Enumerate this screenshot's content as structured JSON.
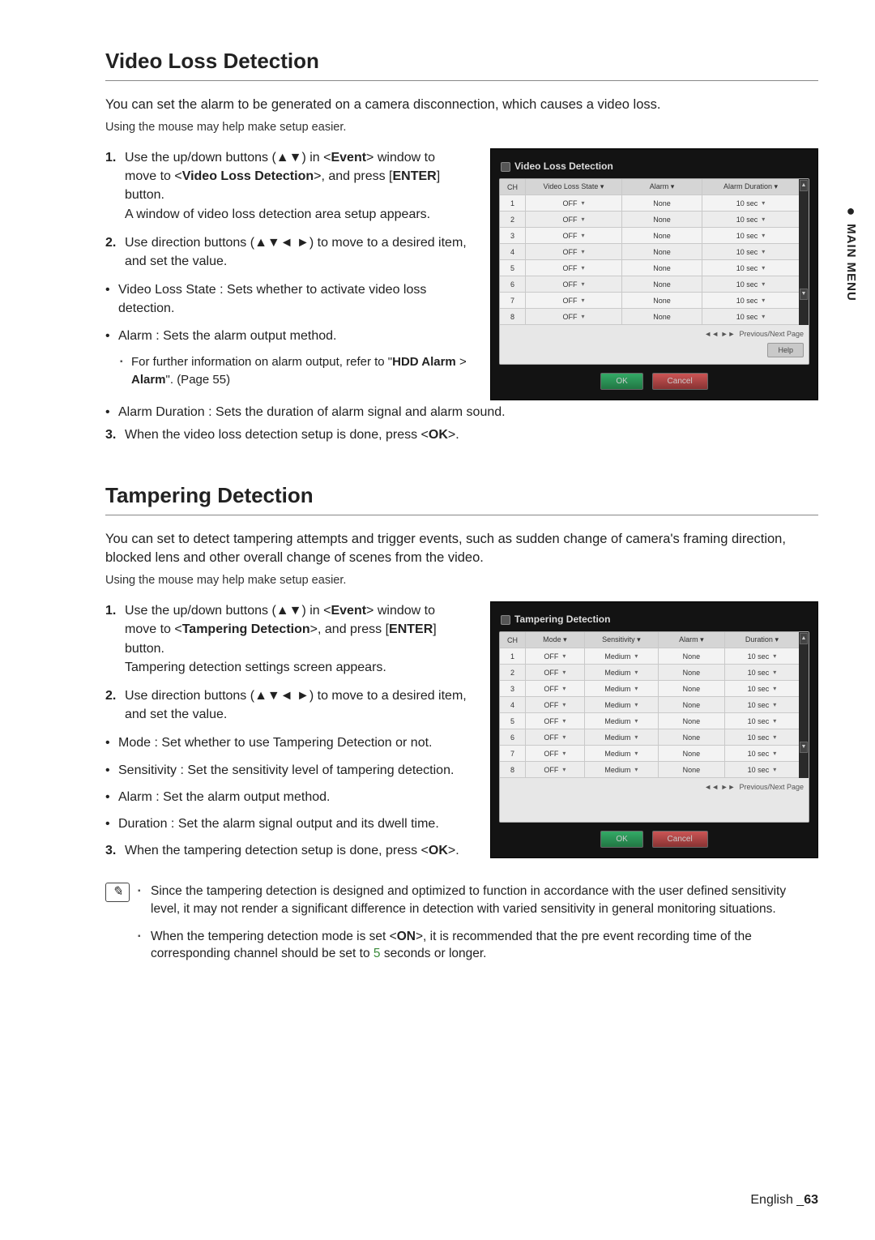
{
  "side_tab": {
    "bullet": "●",
    "label": "MAIN MENU"
  },
  "vld": {
    "title": "Video Loss Detection",
    "intro": "You can set the alarm to be generated on a camera disconnection, which causes a video loss.",
    "sub": "Using the mouse may help make setup easier.",
    "step1": {
      "num": "1.",
      "a": "Use the up/down buttons (▲▼) in <",
      "b": "Event",
      "c": "> window to move to <",
      "d": "Video Loss Detection",
      "e": ">, and press [",
      "f": "ENTER",
      "g": "] button.",
      "h": "A window of video loss detection area setup appears."
    },
    "step2": {
      "num": "2.",
      "txt": "Use direction buttons (▲▼◄ ►) to move to a desired item, and set the value."
    },
    "b1": "Video Loss State : Sets whether to activate video loss detection.",
    "b2": "Alarm : Sets the alarm output method.",
    "b2n_a": "For further information on alarm output, refer to \"",
    "b2n_b": "HDD Alarm",
    "b2n_c": " > ",
    "b2n_d": "Alarm",
    "b2n_e": "\". (Page 55)",
    "b3": "Alarm Duration : Sets the duration of alarm signal and alarm sound.",
    "step3": {
      "num": "3.",
      "a": "When the video loss detection setup is done, press <",
      "b": "OK",
      "c": ">."
    },
    "dialog": {
      "title": "Video Loss Detection",
      "headers": [
        "CH",
        "Video Loss State ▾",
        "Alarm ▾",
        "Alarm Duration ▾"
      ],
      "rows": [
        {
          "ch": "1",
          "state": "OFF",
          "alarm": "None",
          "dur": "10 sec"
        },
        {
          "ch": "2",
          "state": "OFF",
          "alarm": "None",
          "dur": "10 sec"
        },
        {
          "ch": "3",
          "state": "OFF",
          "alarm": "None",
          "dur": "10 sec"
        },
        {
          "ch": "4",
          "state": "OFF",
          "alarm": "None",
          "dur": "10 sec"
        },
        {
          "ch": "5",
          "state": "OFF",
          "alarm": "None",
          "dur": "10 sec"
        },
        {
          "ch": "6",
          "state": "OFF",
          "alarm": "None",
          "dur": "10 sec"
        },
        {
          "ch": "7",
          "state": "OFF",
          "alarm": "None",
          "dur": "10 sec"
        },
        {
          "ch": "8",
          "state": "OFF",
          "alarm": "None",
          "dur": "10 sec"
        }
      ],
      "pager_arrows": "◄◄ ►►",
      "pager": "Previous/Next Page",
      "help": "Help",
      "ok": "OK",
      "cancel": "Cancel"
    }
  },
  "td": {
    "title": "Tampering Detection",
    "intro": "You can set to detect tampering attempts and trigger events, such as sudden change of camera's framing direction, blocked lens and other overall change of scenes from the video.",
    "sub": "Using the mouse may help make setup easier.",
    "step1": {
      "num": "1.",
      "a": "Use the up/down buttons (▲▼) in <",
      "b": "Event",
      "c": "> window to move to <",
      "d": "Tampering Detection",
      "e": ">, and press [",
      "f": "ENTER",
      "g": "] button.",
      "h": "Tampering detection settings screen appears."
    },
    "step2": {
      "num": "2.",
      "txt": "Use direction buttons (▲▼◄ ►) to move to a desired item, and set the value."
    },
    "b1": "Mode : Set whether to use Tampering Detection or not.",
    "b2": "Sensitivity : Set the sensitivity level of tampering detection.",
    "b3": "Alarm : Set the alarm output method.",
    "b4": "Duration : Set the alarm signal output and its dwell time.",
    "step3": {
      "num": "3.",
      "a": "When the tampering detection setup is done, press <",
      "b": "OK",
      "c": ">."
    },
    "note1": "Since the tampering detection is designed and optimized to function in accordance with the user defined sensitivity level, it may not render a significant difference in detection with varied sensitivity in general monitoring situations.",
    "note2_a": "When the tempering detection mode is set <",
    "note2_b": "ON",
    "note2_c": ">, it is recommended that the pre event recording time of the corresponding channel should be set to ",
    "note2_d": "5",
    "note2_e": " seconds or longer.",
    "dialog": {
      "title": "Tampering Detection",
      "headers": [
        "CH",
        "Mode ▾",
        "Sensitivity ▾",
        "Alarm ▾",
        "Duration ▾"
      ],
      "rows": [
        {
          "ch": "1",
          "mode": "OFF",
          "sens": "Medium",
          "alarm": "None",
          "dur": "10 sec"
        },
        {
          "ch": "2",
          "mode": "OFF",
          "sens": "Medium",
          "alarm": "None",
          "dur": "10 sec"
        },
        {
          "ch": "3",
          "mode": "OFF",
          "sens": "Medium",
          "alarm": "None",
          "dur": "10 sec"
        },
        {
          "ch": "4",
          "mode": "OFF",
          "sens": "Medium",
          "alarm": "None",
          "dur": "10 sec"
        },
        {
          "ch": "5",
          "mode": "OFF",
          "sens": "Medium",
          "alarm": "None",
          "dur": "10 sec"
        },
        {
          "ch": "6",
          "mode": "OFF",
          "sens": "Medium",
          "alarm": "None",
          "dur": "10 sec"
        },
        {
          "ch": "7",
          "mode": "OFF",
          "sens": "Medium",
          "alarm": "None",
          "dur": "10 sec"
        },
        {
          "ch": "8",
          "mode": "OFF",
          "sens": "Medium",
          "alarm": "None",
          "dur": "10 sec"
        }
      ],
      "pager_arrows": "◄◄ ►►",
      "pager": "Previous/Next Page",
      "ok": "OK",
      "cancel": "Cancel"
    }
  },
  "footer": {
    "lang": "English ",
    "sep": "_",
    "page": "63"
  },
  "glyph": {
    "note_icon": "✎",
    "sq": "▪"
  }
}
